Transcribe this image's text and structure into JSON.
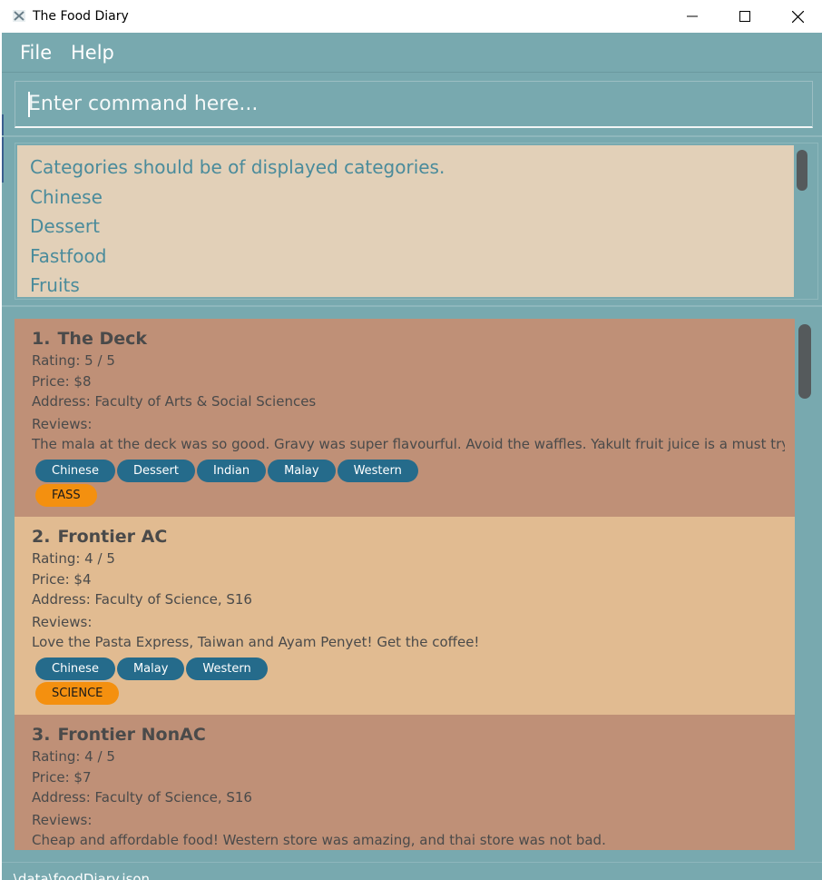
{
  "window": {
    "title": "The Food Diary",
    "icons": {
      "app": "app-icon",
      "minimize": "minimize-icon",
      "maximize": "maximize-icon",
      "close": "close-icon"
    }
  },
  "menu": {
    "file": "File",
    "help": "Help"
  },
  "command": {
    "placeholder": "Enter command here..."
  },
  "result": {
    "lines": [
      "Categories should be of displayed categories.",
      "Chinese",
      "Dessert",
      "Fastfood",
      "Fruits"
    ]
  },
  "entries": [
    {
      "index": "1.",
      "name": "The Deck",
      "rating": "Rating: 5 / 5",
      "price": "Price: $8",
      "address": "Address: Faculty of Arts & Social Sciences",
      "reviews_label": "Reviews:",
      "review": "The mala at the deck was so good. Gravy was super flavourful. Avoid the waffles.  Yakult fruit juice is a must try. ...",
      "categories": [
        "Chinese",
        "Dessert",
        "Indian",
        "Malay",
        "Western"
      ],
      "location": "FASS"
    },
    {
      "index": "2.",
      "name": "Frontier AC",
      "rating": "Rating: 4 / 5",
      "price": "Price: $4",
      "address": "Address: Faculty of Science, S16",
      "reviews_label": "Reviews:",
      "review": "Love the Pasta Express, Taiwan and Ayam Penyet! Get the coffee!",
      "categories": [
        "Chinese",
        "Malay",
        "Western"
      ],
      "location": "SCIENCE"
    },
    {
      "index": "3.",
      "name": "Frontier NonAC",
      "rating": "Rating: 4 / 5",
      "price": "Price: $7",
      "address": "Address: Faculty of Science, S16",
      "reviews_label": "Reviews:",
      "review": "Cheap and affordable food! Western store was amazing, and thai store was not bad.",
      "categories": [],
      "location": ""
    }
  ],
  "status": {
    "path": ".\\data\\foodDiary.json"
  },
  "colors": {
    "background": "#78A9AF",
    "result_box": "#E2D0B8",
    "result_text": "#4a8b9b",
    "card_odd": "#BF9077",
    "card_even": "#E1BB91",
    "category_chip": "#256b8b",
    "location_chip": "#F4900F"
  }
}
